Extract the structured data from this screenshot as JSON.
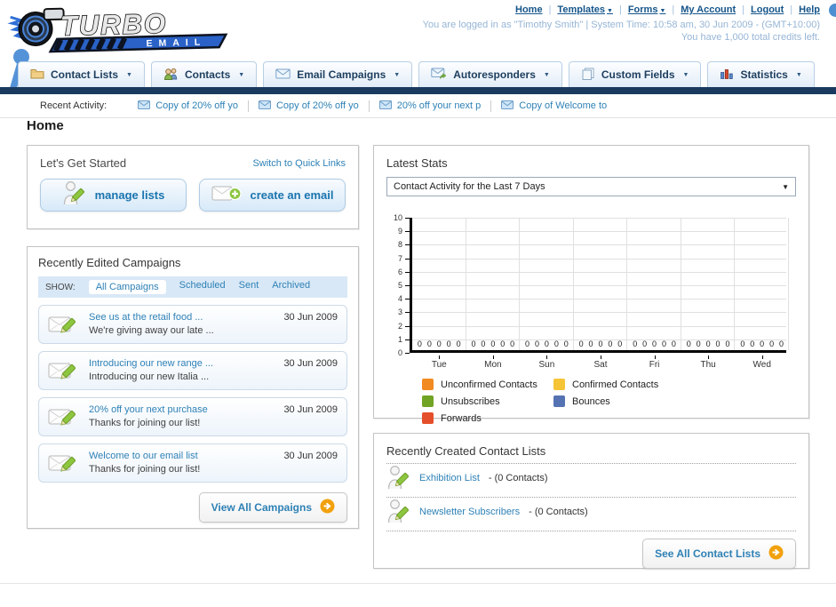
{
  "header": {
    "logo_title": "TURBO",
    "logo_subtitle": "EMAIL",
    "links": [
      {
        "label": "Home",
        "dropdown": false
      },
      {
        "label": "Templates",
        "dropdown": true
      },
      {
        "label": "Forms",
        "dropdown": true
      },
      {
        "label": "My Account",
        "dropdown": false
      },
      {
        "label": "Logout",
        "dropdown": false
      },
      {
        "label": "Help",
        "dropdown": false
      }
    ],
    "login_status": "You are logged in as \"Timothy Smith\" | System Time: 10:58 am, 30 Jun 2009 - (GMT+10:00)",
    "credits": "You have 1,000 total credits left."
  },
  "nav_tabs": [
    {
      "label": "Contact Lists",
      "icon": "folder-icon"
    },
    {
      "label": "Contacts",
      "icon": "contacts-icon"
    },
    {
      "label": "Email Campaigns",
      "icon": "email-icon"
    },
    {
      "label": "Autoresponders",
      "icon": "autoresponder-icon"
    },
    {
      "label": "Custom Fields",
      "icon": "custom-fields-icon"
    },
    {
      "label": "Statistics",
      "icon": "statistics-icon"
    }
  ],
  "recent_activity": {
    "label": "Recent Activity:",
    "items": [
      "Copy of 20% off yo",
      "Copy of 20% off yo",
      "20% off your next p",
      "Copy of Welcome to"
    ]
  },
  "page_title": "Home",
  "get_started": {
    "title": "Let's Get Started",
    "switch_link": "Switch to Quick Links",
    "manage_lists_label": "manage lists",
    "create_email_label": "create an email"
  },
  "campaigns": {
    "title": "Recently Edited Campaigns",
    "show_label": "SHOW:",
    "filters": [
      "All Campaigns",
      "Scheduled",
      "Sent",
      "Archived"
    ],
    "active_filter": "All Campaigns",
    "items": [
      {
        "title": "See us at the retail food ...",
        "subtitle": "We're giving away our late ...",
        "date": "30 Jun 2009"
      },
      {
        "title": "Introducing our new range ...",
        "subtitle": "Introducing our new Italia ...",
        "date": "30 Jun 2009"
      },
      {
        "title": "20% off your next purchase",
        "subtitle": "Thanks for joining our list!",
        "date": "30 Jun 2009"
      },
      {
        "title": "Welcome to our email list",
        "subtitle": "Thanks for joining our list!",
        "date": "30 Jun 2009"
      }
    ],
    "view_all_label": "View All Campaigns"
  },
  "stats": {
    "title": "Latest Stats",
    "selected_option": "Contact Activity for the Last 7 Days"
  },
  "chart_data": {
    "type": "bar",
    "title": "Contact Activity for the Last 7 Days",
    "categories": [
      "Tue",
      "Mon",
      "Sun",
      "Sat",
      "Fri",
      "Thu",
      "Wed"
    ],
    "series": [
      {
        "name": "Unconfirmed Contacts",
        "color": "#f18a21",
        "values": [
          0,
          0,
          0,
          0,
          0,
          0,
          0
        ]
      },
      {
        "name": "Confirmed Contacts",
        "color": "#f6c437",
        "values": [
          0,
          0,
          0,
          0,
          0,
          0,
          0
        ]
      },
      {
        "name": "Unsubscribes",
        "color": "#71a424",
        "values": [
          0,
          0,
          0,
          0,
          0,
          0,
          0
        ]
      },
      {
        "name": "Bounces",
        "color": "#5572b2",
        "values": [
          0,
          0,
          0,
          0,
          0,
          0,
          0
        ]
      },
      {
        "name": "Forwards",
        "color": "#e54e2a",
        "values": [
          0,
          0,
          0,
          0,
          0,
          0,
          0
        ]
      }
    ],
    "ylim": [
      0,
      10
    ],
    "yticks": [
      10,
      9,
      8,
      7,
      6,
      5,
      4,
      3,
      2,
      1,
      0
    ],
    "grid": true,
    "legend_position": "bottom",
    "data_labels": "each bar value shown as 0 above x-axis"
  },
  "contact_lists": {
    "title": "Recently Created Contact Lists",
    "items": [
      {
        "name": "Exhibition List",
        "detail": "- (0 Contacts)"
      },
      {
        "name": "Newsletter Subscribers",
        "detail": "- (0 Contacts)"
      }
    ],
    "see_all_label": "See All Contact Lists"
  }
}
